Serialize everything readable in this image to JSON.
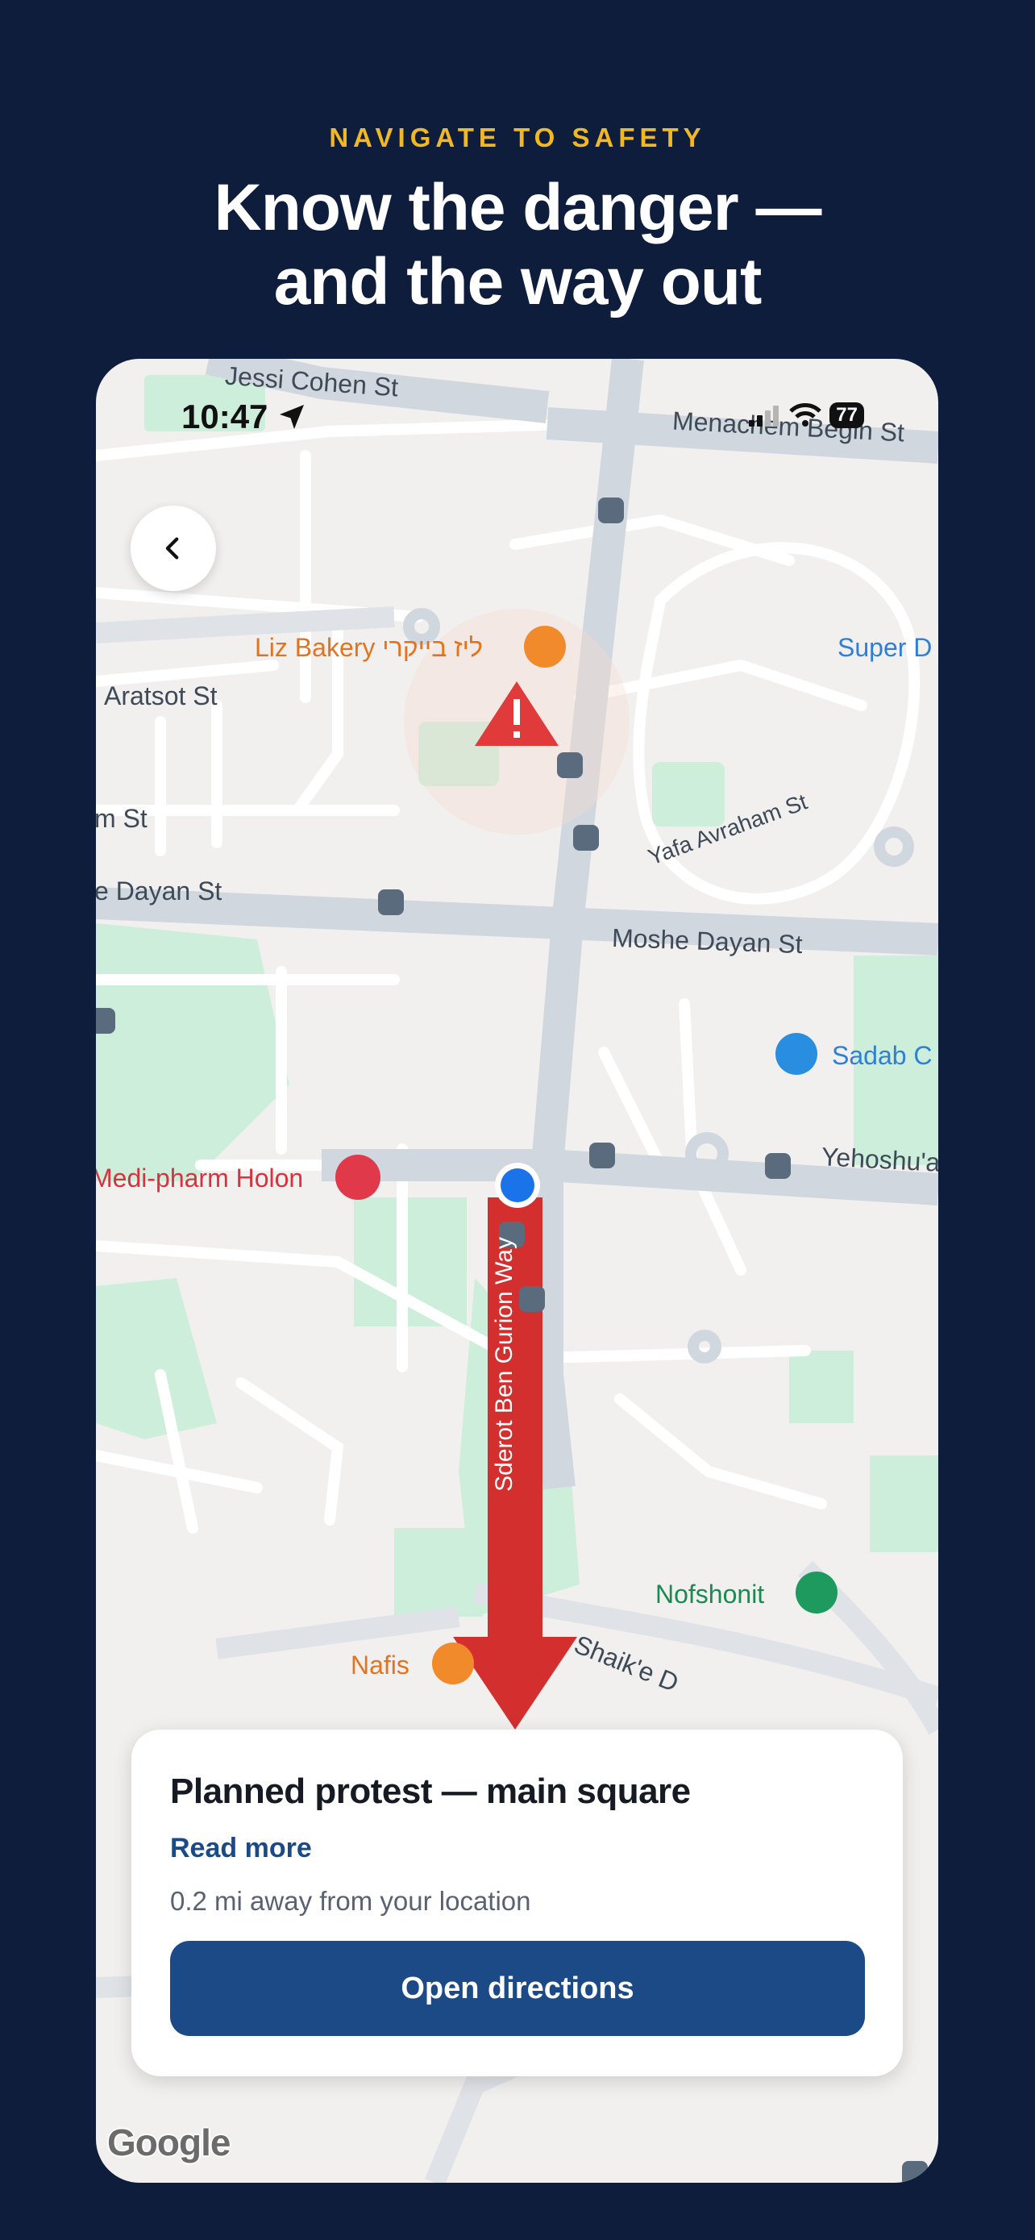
{
  "header": {
    "eyebrow": "NAVIGATE TO SAFETY",
    "headline_line1": "Know the danger —",
    "headline_line2": "and the way out"
  },
  "status_bar": {
    "time": "10:47",
    "battery": "77",
    "icons": [
      "location-arrow-icon",
      "signal-icon",
      "wifi-icon",
      "battery-icon"
    ]
  },
  "map": {
    "streets": {
      "jessi_cohen": "Jessi Cohen St",
      "menachem_begin": "Menachem Begin St",
      "aratsot": "Aratsot St",
      "m_st": "m St",
      "dayan_left": "e Dayan St",
      "moshe_dayan": "Moshe Dayan St",
      "yafa_avraham": "Yafa Avraham St",
      "yehoshua": "Yehoshu'a",
      "sderot": "Sderot Ben Gurion Way",
      "shaike": "Shaik'e D"
    },
    "pois": {
      "liz_bakery": "Liz Bakery ליז בייקרי",
      "super_d": "Super D",
      "sadab": "Sadab C",
      "medipharm": "Medi-pharm Holon",
      "nofshonit": "Nofshonit",
      "nafis": "Nafis"
    },
    "route_color": "#d32f2f",
    "user_dot_color": "#1a73e8",
    "attribution": "Google"
  },
  "card": {
    "title": "Planned protest — main square",
    "link": "Read more",
    "distance": "0.2 mi away from your location",
    "button": "Open directions"
  }
}
